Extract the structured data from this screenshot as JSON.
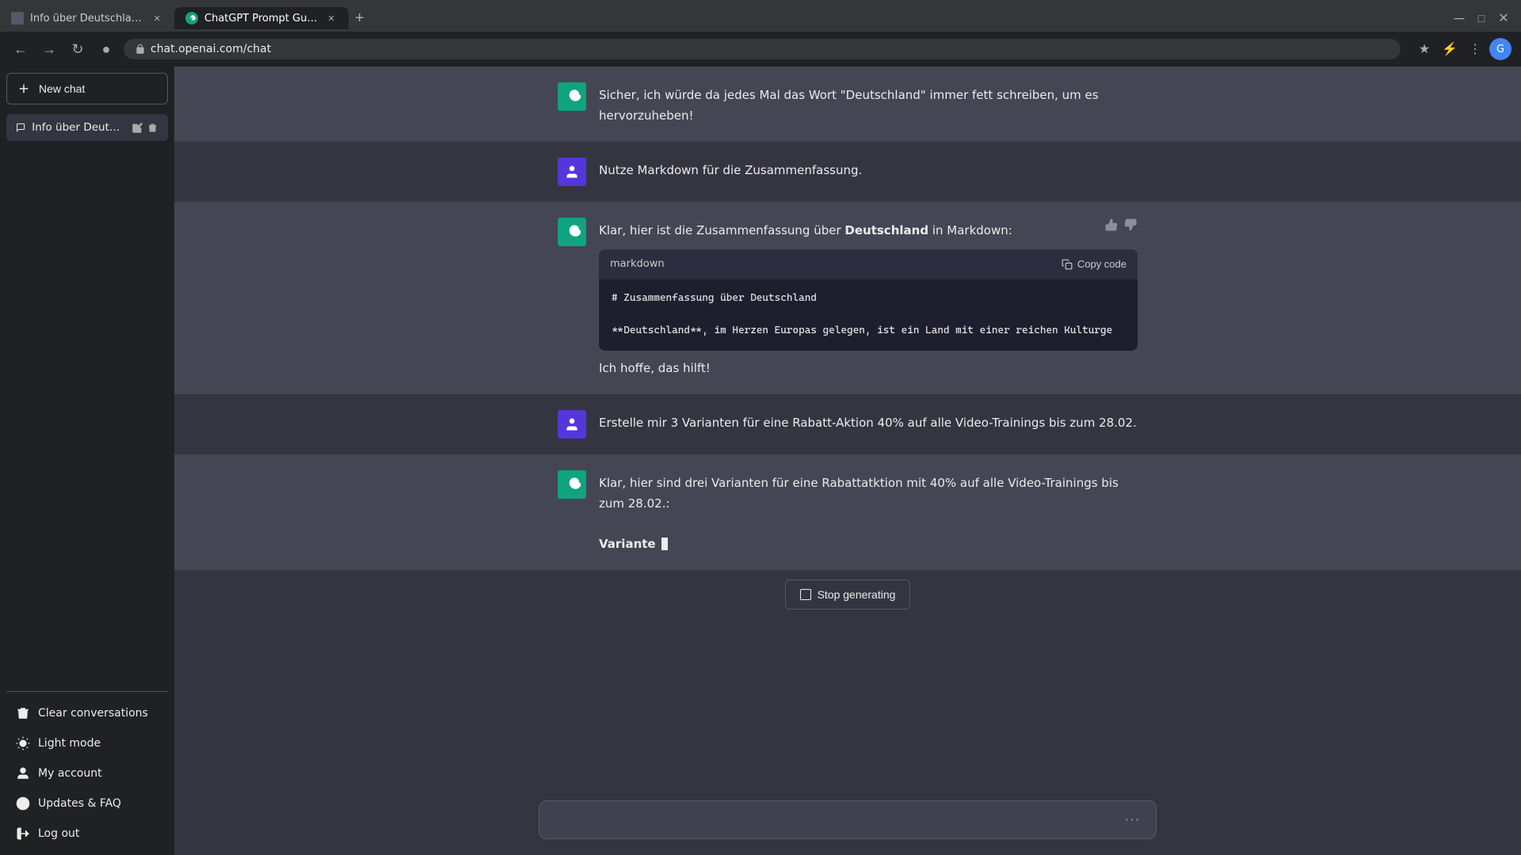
{
  "browser": {
    "tabs": [
      {
        "id": "tab1",
        "title": "Info über Deutschland.",
        "url": "",
        "favicon_color": "#565869",
        "active": false
      },
      {
        "id": "tab2",
        "title": "ChatGPT Prompt Guide",
        "url": "",
        "favicon_color": "#10a37f",
        "active": true
      }
    ],
    "address": "chat.openai.com/chat",
    "new_tab_label": "+"
  },
  "sidebar": {
    "new_chat_label": "New chat",
    "conversations": [
      {
        "id": "conv1",
        "title": "Info über Deutschland.",
        "active": true
      }
    ],
    "bottom_items": [
      {
        "id": "clear",
        "label": "Clear conversations",
        "icon": "trash"
      },
      {
        "id": "light_mode",
        "label": "Light mode",
        "icon": "sun"
      },
      {
        "id": "my_account",
        "label": "My account",
        "icon": "user"
      },
      {
        "id": "updates",
        "label": "Updates & FAQ",
        "icon": "info"
      },
      {
        "id": "logout",
        "label": "Log out",
        "icon": "logout"
      }
    ]
  },
  "messages": [
    {
      "id": "msg1",
      "role": "user",
      "text_parts": [
        "Nutze Markdown für die Zusammenfassung."
      ],
      "show_feedback": false
    },
    {
      "id": "msg2",
      "role": "assistant",
      "text_before": "Klar, hier ist die Zusammenfassung über ",
      "bold_word": "Deutschland",
      "text_after": " in Markdown:",
      "has_code": true,
      "code_lang": "markdown",
      "code_copy_label": "Copy code",
      "code_line1": "# Zusammenfassung über Deutschland",
      "code_line2": "",
      "code_line3": "**Deutschland**, im Herzen Europas gelegen, ist ein Land mit einer reichen Kulturge",
      "text_bottom": "Ich hoffe, das hilft!",
      "show_feedback": true
    },
    {
      "id": "msg3",
      "role": "user",
      "text_parts": [
        "Erstelle mir 3 Varianten für eine Rabatt-Aktion 40% auf alle Video-Trainings bis zum 28.02."
      ],
      "show_feedback": false
    },
    {
      "id": "msg4",
      "role": "assistant",
      "text_before": "Klar, hier sind drei Varianten für eine Rabattatktion mit 40% auf alle Video-Trainings bis zum 28.02.:",
      "bold_word": "",
      "text_after": "",
      "has_code": false,
      "text_variant": "**Variante ",
      "show_cursor": true,
      "show_feedback": false
    }
  ],
  "stop_generating_label": "Stop generating",
  "input_placeholder": "",
  "dots_label": "···"
}
